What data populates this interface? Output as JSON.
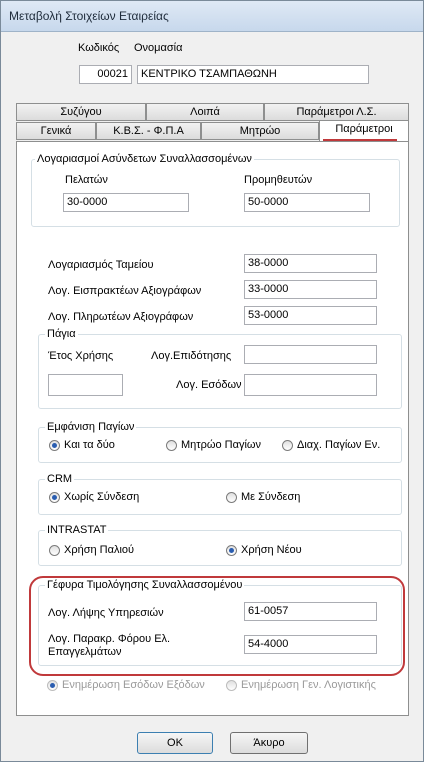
{
  "window": {
    "title": "Μεταβολή Στοιχείων Εταιρείας"
  },
  "company": {
    "code_label": "Κωδικός",
    "name_label": "Ονομασία",
    "code": "00021",
    "name": "ΚΕΝΤΡΙΚΟ ΤΣΑΜΠΑΘΩΝΗ"
  },
  "tabs": {
    "row1": [
      "Συζύγου",
      "Λοιπά",
      "Παράμετροι Λ.Σ."
    ],
    "row2": [
      "Γενικά",
      "Κ.Β.Σ. - Φ.Π.Α",
      "Μητρώο",
      "Παράμετροι"
    ]
  },
  "unlinked_accounts": {
    "title": "Λογαριασμοί Ασύνδετων Συναλλασσομένων",
    "customers_label": "Πελατών",
    "suppliers_label": "Προμηθευτών",
    "customers": "30-0000",
    "suppliers": "50-0000"
  },
  "accounts": {
    "cash_label": "Λογαριασμός Ταμείου",
    "cash": "38-0000",
    "receivables_label": "Λογ. Εισπρακτέων Αξιογράφων",
    "receivables": "33-0000",
    "payables_label": "Λογ. Πληρωτέων Αξιογράφων",
    "payables": "53-0000"
  },
  "fixed_assets": {
    "title": "Πάγια",
    "year_label": "Έτος Χρήσης",
    "subsidy_label": "Λογ.Επιδότησης",
    "income_label": "Λογ. Εσόδων",
    "year": "",
    "subsidy": "",
    "income": ""
  },
  "assets_display": {
    "title": "Εμφάνιση Παγίων",
    "options": [
      "Και τα δύο",
      "Μητρώο Παγίων",
      "Διαχ. Παγίων Εν."
    ],
    "selected": 0
  },
  "crm": {
    "title": "CRM",
    "options": [
      "Χωρίς Σύνδεση",
      "Με Σύνδεση"
    ],
    "selected": 0
  },
  "intrastat": {
    "title": "INTRASTAT",
    "options": [
      "Χρήση Παλιού",
      "Χρήση Νέου"
    ],
    "selected": 1
  },
  "invoicing_bridge": {
    "title": "Γέφυρα Τιμολόγησης Συναλλασσομένου",
    "services_label": "Λογ. Λήψης Υπηρεσιών",
    "services": "61-0057",
    "withholding_label": "Λογ. Παρακρ. Φόρου Ελ. Επαγγελμάτων",
    "withholding": "54-4000"
  },
  "update_options": [
    "Ενημέρωση Εσόδων Εξόδων",
    "Ενημέρωση Γεν. Λογιστικής"
  ],
  "buttons": {
    "ok": "ΟΚ",
    "cancel": "Άκυρο"
  },
  "colors": {
    "highlight": "#c0393b",
    "active_tab_underline": "#c0393b"
  }
}
